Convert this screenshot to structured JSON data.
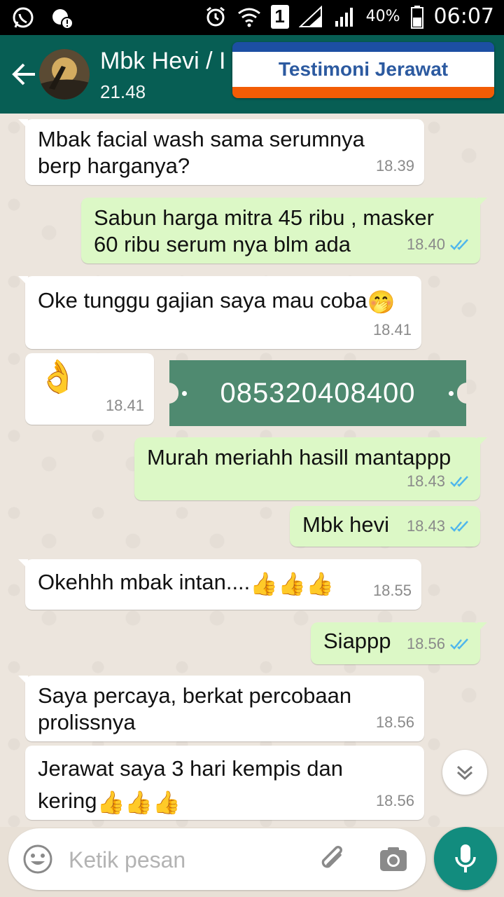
{
  "status_bar": {
    "time": "06:07",
    "battery_percent": "40%",
    "sim_label": "1",
    "left_icons": [
      "whatsapp-icon",
      "alert-icon"
    ],
    "right_icons": [
      "alarm-icon",
      "wifi-icon",
      "sim-icon",
      "signal-icon",
      "signal-icon",
      "battery-icon"
    ]
  },
  "header": {
    "contact_name": "Mbk Hevi / I",
    "last_seen": "21.48",
    "banner_text": "Testimoni Jerawat"
  },
  "messages": [
    {
      "dir": "in",
      "lines": [
        "Mbak facial wash sama serumnya",
        "berp harganya?"
      ],
      "time": "18.39"
    },
    {
      "dir": "out",
      "lines": [
        "Sabun harga mitra 45 ribu , masker",
        "60 ribu serum nya blm ada"
      ],
      "time": "18.40"
    },
    {
      "dir": "in",
      "lines": [
        "Oke tunggu gajian saya mau coba"
      ],
      "emoji": "🤭",
      "time": "18.41"
    },
    {
      "dir": "in",
      "emoji": "👌",
      "time": "18.41"
    },
    {
      "dir": "out",
      "lines": [
        "Murah meriahh hasill mantappp"
      ],
      "time": "18.43"
    },
    {
      "dir": "out",
      "lines": [
        "Mbk hevi"
      ],
      "time": "18.43"
    },
    {
      "dir": "in",
      "lines": [
        "Okehhh mbak intan...."
      ],
      "emoji": "👍👍👍",
      "time": "18.55"
    },
    {
      "dir": "out",
      "lines": [
        "Siappp"
      ],
      "time": "18.56"
    },
    {
      "dir": "in",
      "lines": [
        "Saya percaya, berkat percobaan",
        "prolissnya"
      ],
      "time": "18.56"
    },
    {
      "dir": "in",
      "lines": [
        "Jerawat saya 3 hari kempis dan",
        "kering"
      ],
      "emoji": "👍👍👍",
      "time": "18.56"
    }
  ],
  "overlay_phone": "085320408400",
  "input": {
    "placeholder": "Ketik pesan"
  },
  "colors": {
    "appbar": "#075e54",
    "out_bubble": "#dcf8c6",
    "in_bubble": "#ffffff",
    "mic_button": "#128c7e",
    "tick_read": "#4fb6ec",
    "ribbon": "#4f8a70"
  }
}
